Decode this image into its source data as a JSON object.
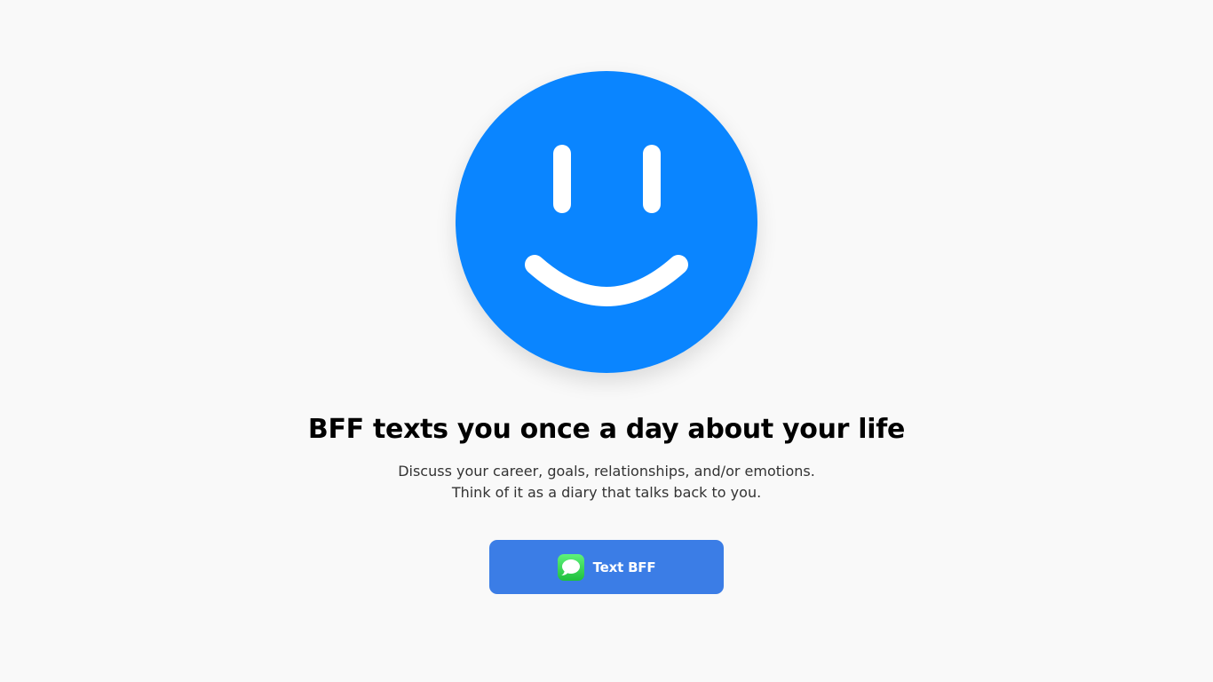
{
  "hero": {
    "logo_icon": "smiley-face-icon",
    "headline": "BFF texts you once a day about your life",
    "subtext_line1": "Discuss your career, goals, relationships, and/or emotions.",
    "subtext_line2": "Think of it as a diary that talks back to you."
  },
  "cta": {
    "label": "Text BFF",
    "icon": "messages-app-icon"
  },
  "colors": {
    "page_background": "#f9f9f9",
    "logo_blue": "#0a85ff",
    "button_blue": "#3b7de6",
    "messages_green": "#34c759",
    "headline_text": "#000000",
    "body_text": "#333333"
  }
}
